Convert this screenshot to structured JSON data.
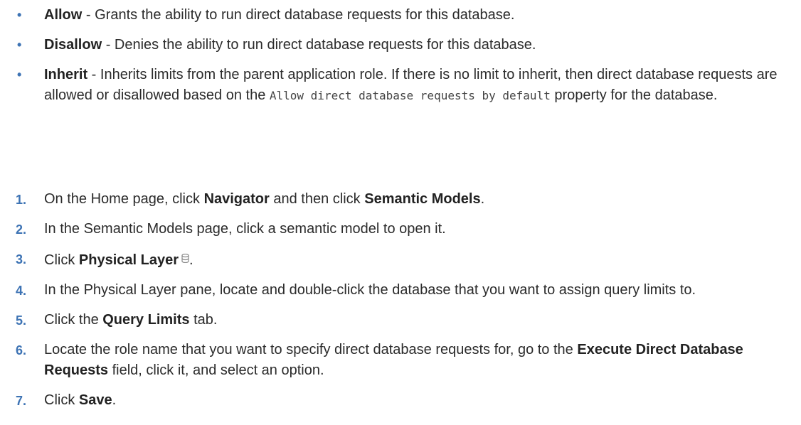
{
  "bullets": [
    {
      "marker": "•",
      "term": "Allow",
      "text": " - Grants the ability to run direct database requests for this database."
    },
    {
      "marker": "•",
      "term": "Disallow",
      "text": " - Denies the ability to run direct database requests for this database."
    },
    {
      "marker": "•",
      "term": "Inherit",
      "text_before": " - Inherits limits from the parent application role. If there is no limit to inherit, then direct database requests are allowed or disallowed based on the ",
      "code": "Allow direct database requests by default",
      "text_after": " property for the database."
    }
  ],
  "steps": [
    {
      "number": "1.",
      "t1": "On the Home page, click ",
      "b1": "Navigator",
      "t2": " and then click ",
      "b2": "Semantic Models",
      "t3": "."
    },
    {
      "number": "2.",
      "t1": "In the Semantic Models page, click a semantic model to open it."
    },
    {
      "number": "3.",
      "t1": "Click ",
      "b1": "Physical Layer",
      "icon": "database-icon",
      "t2": "."
    },
    {
      "number": "4.",
      "t1": "In the Physical Layer pane, locate and double-click the database that you want to assign query limits to."
    },
    {
      "number": "5.",
      "t1": "Click the ",
      "b1": "Query Limits",
      "t2": " tab."
    },
    {
      "number": "6.",
      "t1": "Locate the role name that you want to specify direct database requests for, go to the ",
      "b1": "Execute Direct Database Requests",
      "t2": " field, click it, and select an option."
    },
    {
      "number": "7.",
      "t1": "Click ",
      "b1": "Save",
      "t2": "."
    }
  ],
  "colors": {
    "marker": "#3d73b4",
    "text": "#2b2b2b"
  }
}
